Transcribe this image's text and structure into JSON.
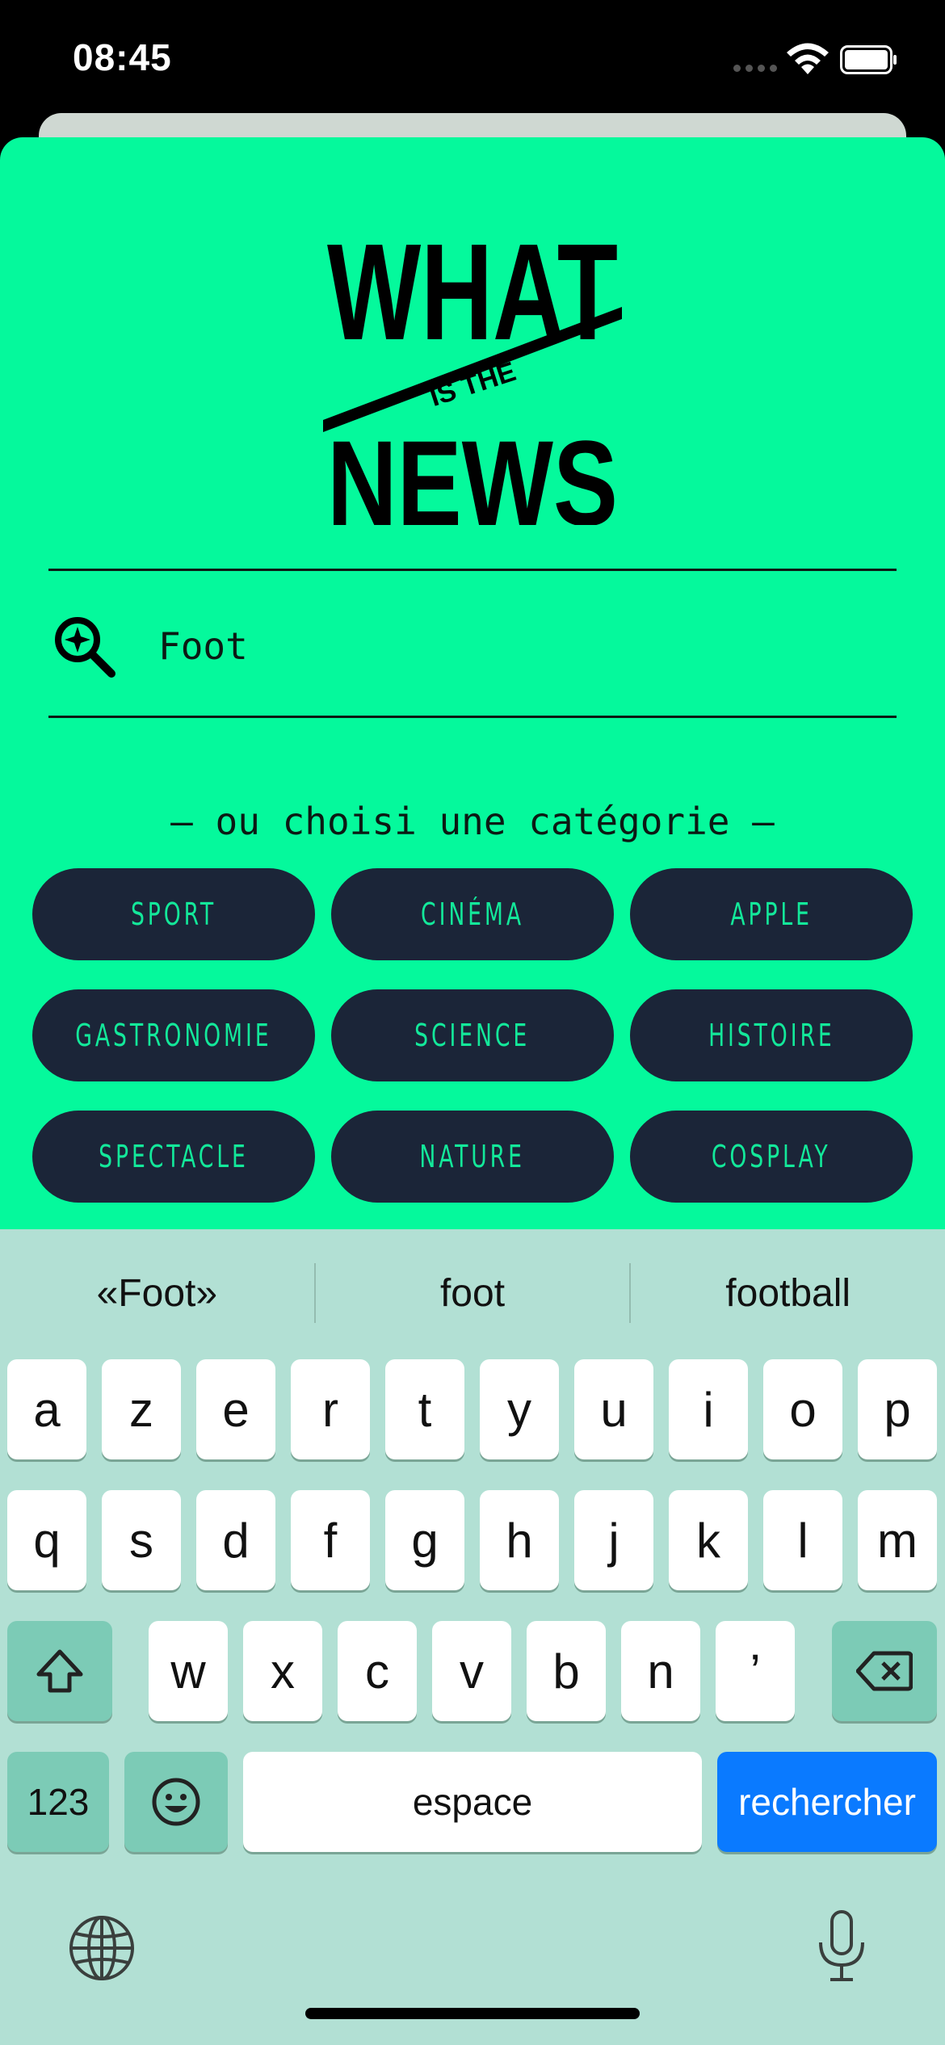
{
  "status_bar": {
    "time": "08:45"
  },
  "logo": {
    "line1": "WHAT",
    "line2": "IS THE",
    "line3": "NEWS"
  },
  "search": {
    "value": "Foot",
    "placeholder": ""
  },
  "categories": {
    "heading": "— ou choisi une catégorie —",
    "items": [
      {
        "label": "SPORT"
      },
      {
        "label": "CINÉMA"
      },
      {
        "label": "APPLE"
      },
      {
        "label": "GASTRONOMIE"
      },
      {
        "label": "SCIENCE"
      },
      {
        "label": "HISTOIRE"
      },
      {
        "label": "SPECTACLE"
      },
      {
        "label": "NATURE"
      },
      {
        "label": "COSPLAY"
      }
    ]
  },
  "keyboard": {
    "suggestions": [
      "«Foot»",
      "foot",
      "football"
    ],
    "row1": [
      "a",
      "z",
      "e",
      "r",
      "t",
      "y",
      "u",
      "i",
      "o",
      "p"
    ],
    "row2": [
      "q",
      "s",
      "d",
      "f",
      "g",
      "h",
      "j",
      "k",
      "l",
      "m"
    ],
    "row3": [
      "w",
      "x",
      "c",
      "v",
      "b",
      "n",
      "’"
    ],
    "numbers_label": "123",
    "space_label": "espace",
    "return_label": "rechercher"
  },
  "colors": {
    "sheet": "#05f99c",
    "button_bg": "#1b2538",
    "button_text": "#13e89a",
    "keyboard_bg": "#b2e0d4",
    "return_key": "#0a7aff"
  }
}
